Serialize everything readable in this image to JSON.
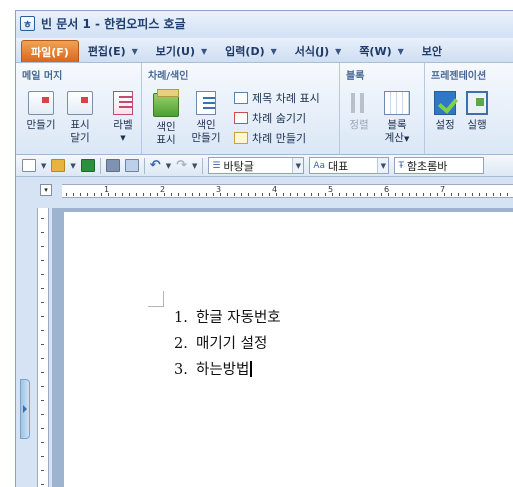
{
  "window": {
    "title": "빈 문서 1 - 한컴오피스 호글",
    "icon": "hwp-app-icon"
  },
  "menu": [
    {
      "label": "파일(F)",
      "active": true
    },
    {
      "label": "편집(E)",
      "active": false
    },
    {
      "label": "보기(U)",
      "active": false
    },
    {
      "label": "입력(D)",
      "active": false
    },
    {
      "label": "서식(J)",
      "active": false
    },
    {
      "label": "쪽(W)",
      "active": false
    },
    {
      "label": "보안",
      "active": false
    }
  ],
  "ribbon": {
    "mail_merge": {
      "title": "메일 머지",
      "make_top": "만들기",
      "show_top": "표시",
      "show_bottom": "달기",
      "label_top": "라벨"
    },
    "toc_index": {
      "title": "차례/색인",
      "index_show_top": "색인",
      "index_show_bottom": "표시",
      "index_make_top": "색인",
      "index_make_bottom": "만들기",
      "title_toc": "제목 차례 표시",
      "hide_toc": "차례 숨기기",
      "make_toc": "차례 만들기"
    },
    "block": {
      "title": "블록",
      "sort": "정렬",
      "calc_top": "블록",
      "calc_bottom": "계산"
    },
    "presentation": {
      "title": "프레젠테이션",
      "settings": "설정",
      "run": "실행"
    }
  },
  "toolbar": {
    "style_value": "바탕글",
    "para_value": "대표",
    "font_value": "함초롬바"
  },
  "ruler": {
    "numbers": [
      "1",
      "2",
      "3",
      "4",
      "5",
      "6",
      "7"
    ]
  },
  "document": {
    "list": [
      {
        "num": "1.",
        "text": "한글 자동번호"
      },
      {
        "num": "2.",
        "text": "매기기 설정"
      },
      {
        "num": "3.",
        "text": "하는방법"
      }
    ]
  }
}
